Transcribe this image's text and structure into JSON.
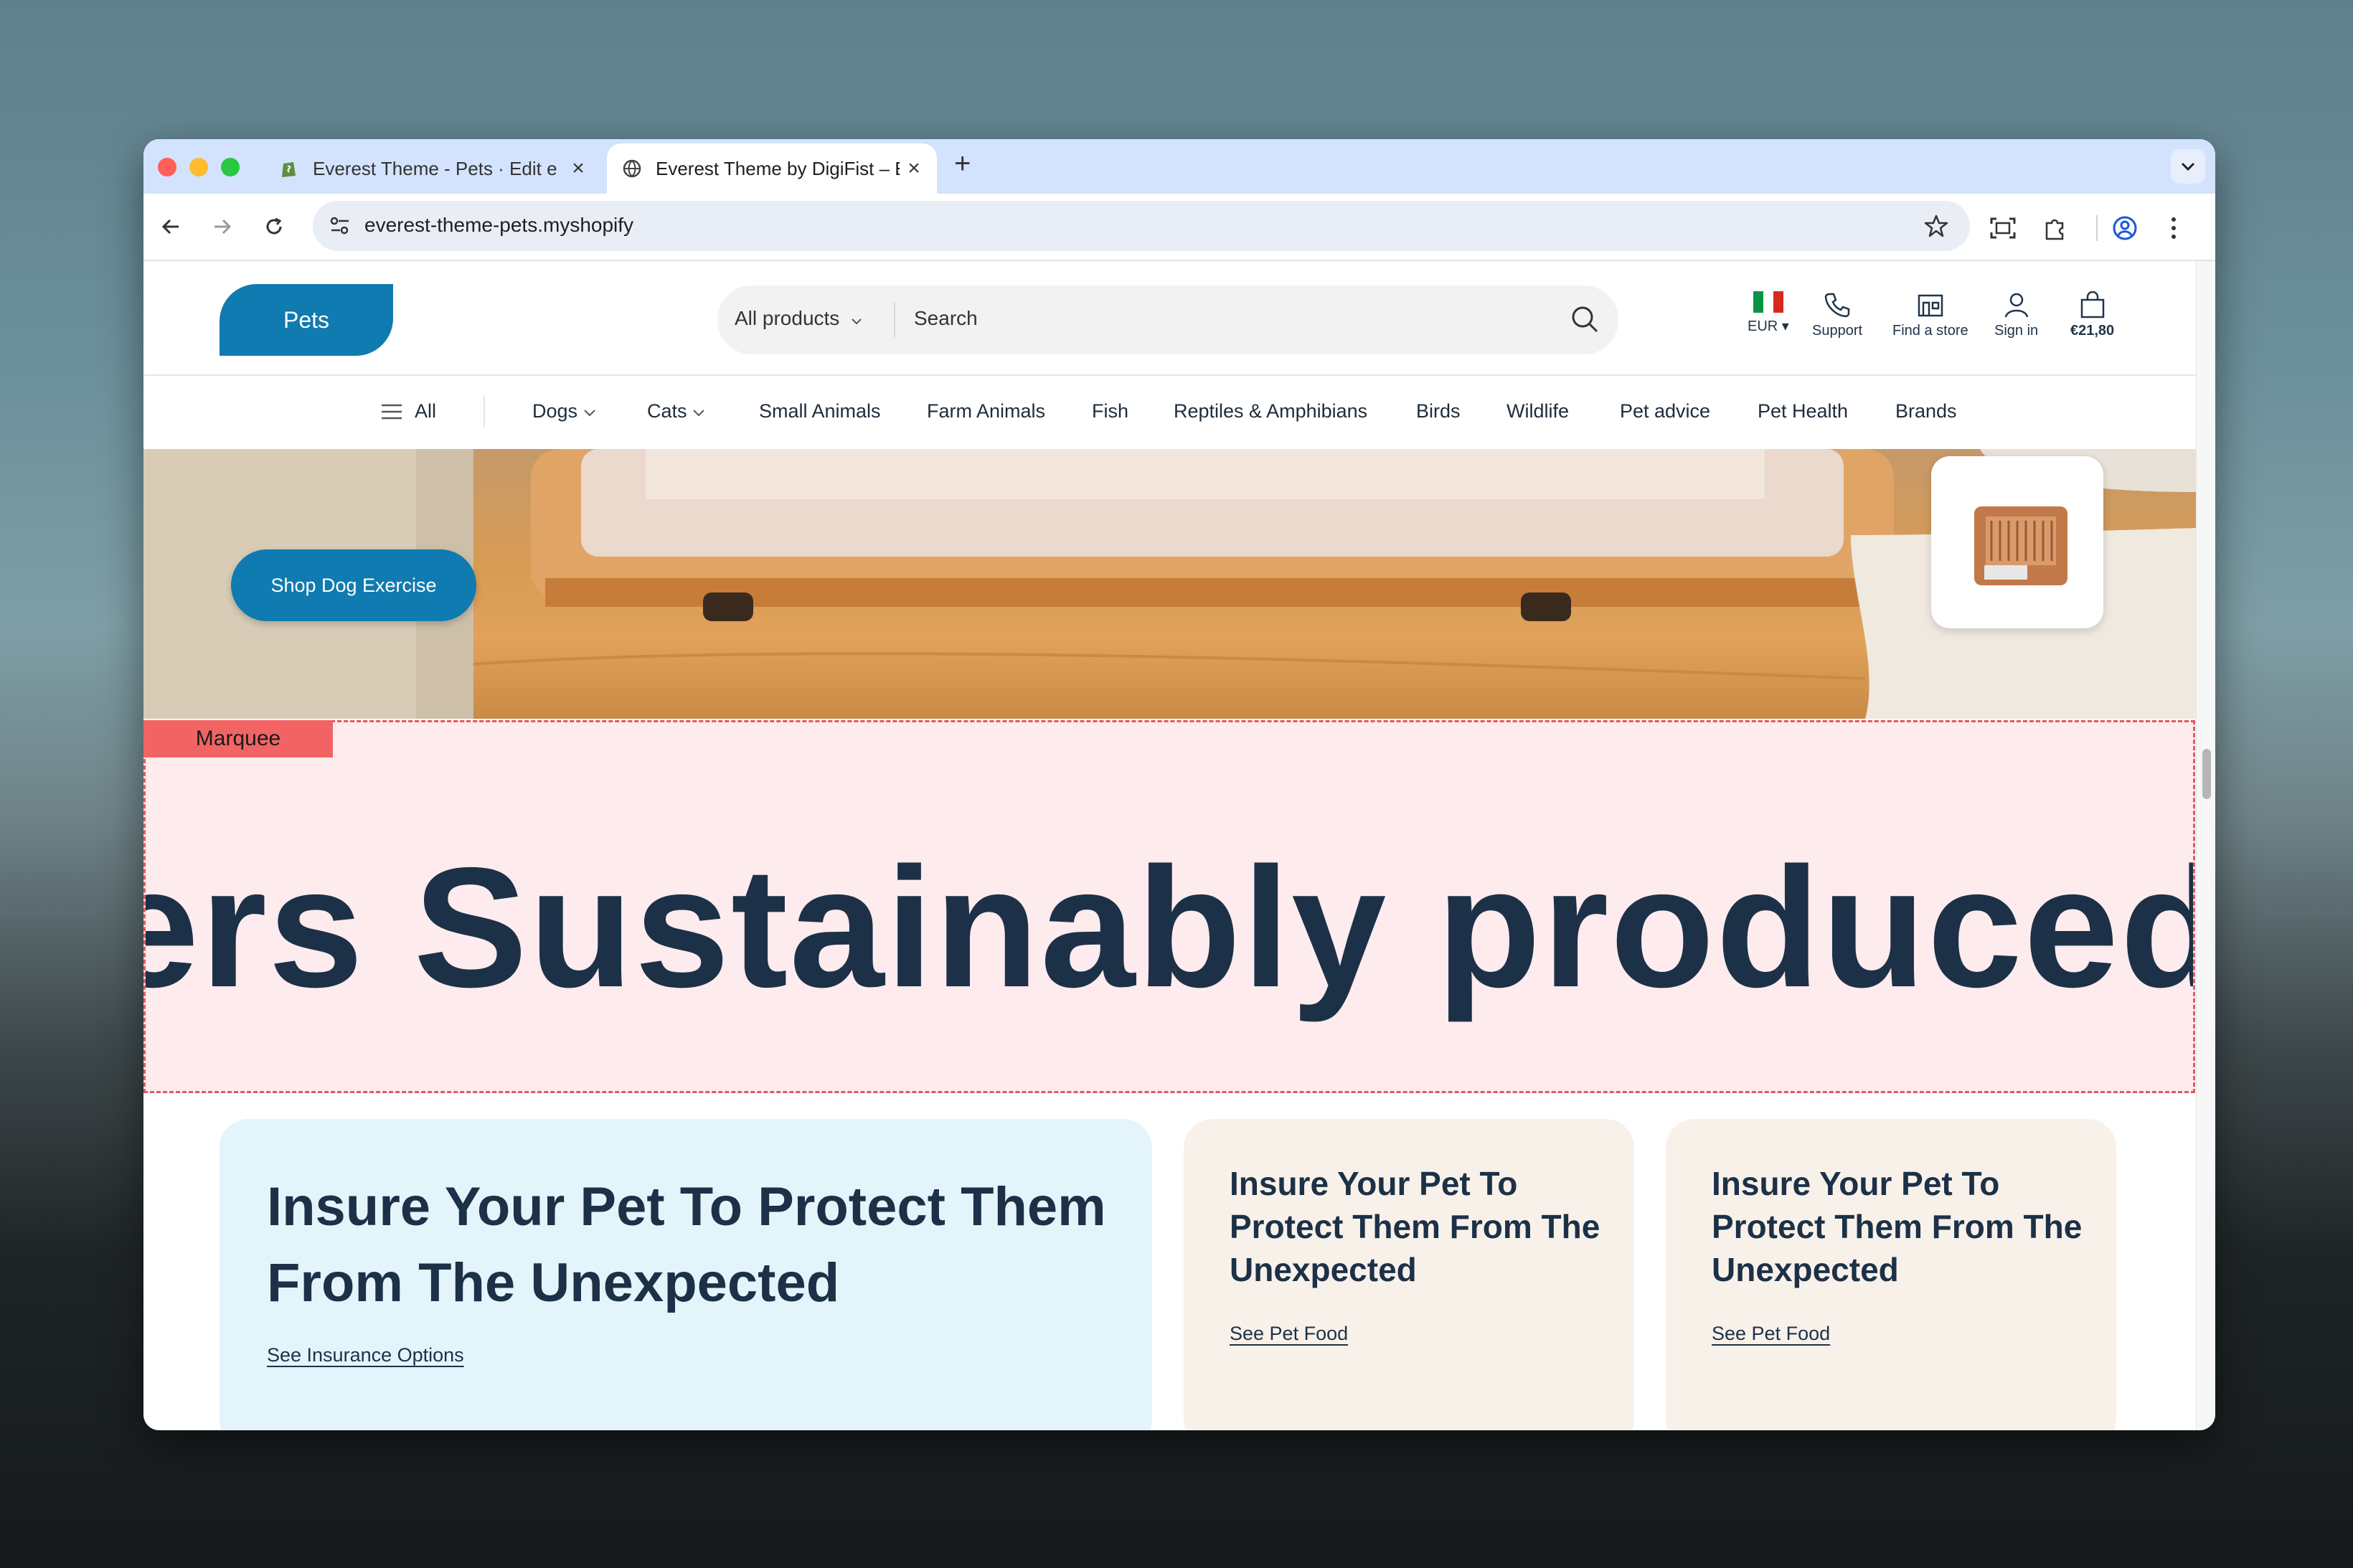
{
  "browser": {
    "tabs": [
      {
        "title": "Everest Theme - Pets · Edit e",
        "favicon": "shopify-icon",
        "active": false
      },
      {
        "title": "Everest Theme by DigiFist – E",
        "favicon": "globe-icon",
        "active": true
      }
    ],
    "url": "everest-theme-pets.myshopify"
  },
  "header": {
    "logo": "Pets",
    "search": {
      "category": "All products",
      "placeholder": "Search"
    },
    "utilities": {
      "currency": "EUR",
      "support": "Support",
      "store": "Find a store",
      "signin": "Sign in",
      "cart": "€21,80"
    }
  },
  "nav": {
    "all": "All",
    "items": [
      "Dogs",
      "Cats",
      "Small Animals",
      "Farm Animals",
      "Fish",
      "Reptiles & Amphibians",
      "Birds",
      "Wildlife",
      "Pet advice",
      "Pet Health",
      "Brands"
    ]
  },
  "hero": {
    "button": "Shop Dog Exercise"
  },
  "marquee": {
    "tag": "Marquee",
    "text": "ers  Sustainably produced"
  },
  "cards": [
    {
      "title": "Insure Your Pet To Protect Them From The Unexpected",
      "link": "See Insurance Options",
      "bg": "#e3f5fb"
    },
    {
      "title": "Insure Your Pet To Protect Them From The Unexpected",
      "link": "See Pet Food",
      "bg": "#f8f1ea"
    },
    {
      "title": "Insure Your Pet To Protect Them From The Unexpected",
      "link": "See Pet Food",
      "bg": "#f8f1ea"
    }
  ],
  "colors": {
    "brand": "#0f7bb0",
    "heading": "#1c3147",
    "marquee_bg": "#fdebee",
    "marquee_border": "#e05a5f"
  }
}
